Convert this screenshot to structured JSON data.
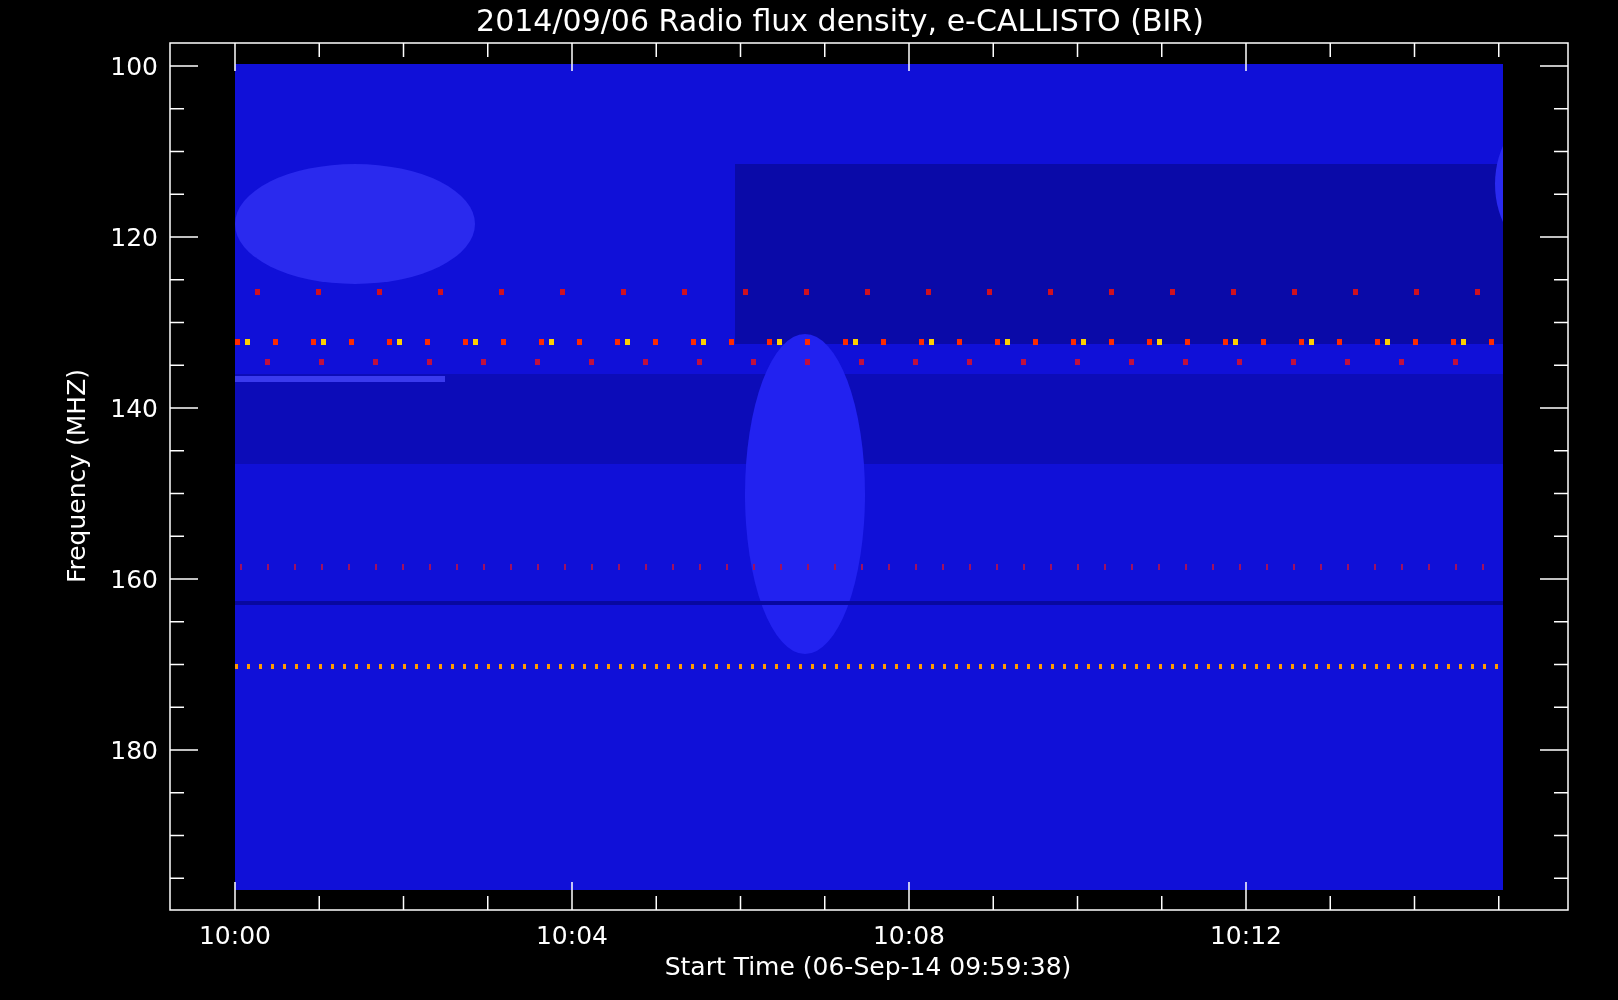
{
  "title": "2014/09/06  Radio flux density, e-CALLISTO (BIR)",
  "y_axis": {
    "label": "Frequency (MHZ)",
    "ticks": [
      "100",
      "120",
      "140",
      "160",
      "180"
    ]
  },
  "x_axis": {
    "label": "Start Time (06-Sep-14 09:59:38)",
    "ticks": [
      "10:00",
      "10:04",
      "10:08",
      "10:12"
    ]
  }
}
